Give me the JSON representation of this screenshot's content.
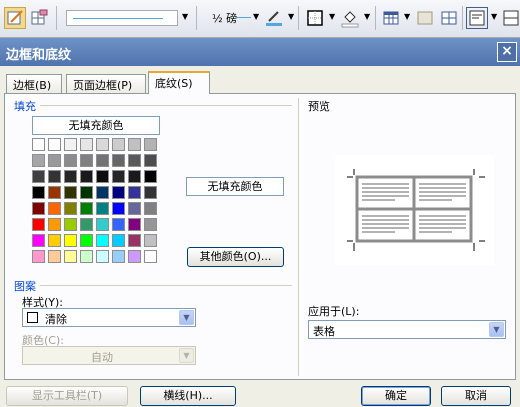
{
  "dialog": {
    "title": "边框和底纹"
  },
  "tabs": [
    {
      "label": "边框(B)",
      "active": false
    },
    {
      "label": "页面边框(P)",
      "active": false
    },
    {
      "label": "底纹(S)",
      "active": true
    }
  ],
  "fill": {
    "heading": "填充",
    "no_fill_button": "无填充颜色",
    "selected_display": "无填充颜色",
    "more_colors_button": "其他颜色(O)...",
    "palette_rows": [
      [
        "#ffffff",
        "#ffffff",
        "#f2f2f2",
        "#e6e6e6",
        "#d9d9d9",
        "#cccccc",
        "#c0c0c0",
        "#b3b3b3"
      ],
      [
        "#a6a6a6",
        "#999999",
        "#8c8c8c",
        "#808080",
        "#737373",
        "#666666",
        "#595959",
        "#4d4d4d"
      ],
      [
        "#404040",
        "#333333",
        "#262626",
        "#1a1a1a",
        "#0d0d0d",
        "#262626",
        "#1a1a1a",
        "#000000"
      ],
      [
        "#000000",
        "#993300",
        "#333300",
        "#003300",
        "#003366",
        "#000080",
        "#333399",
        "#333333"
      ],
      [
        "#800000",
        "#ff6600",
        "#808000",
        "#008000",
        "#008080",
        "#0000ff",
        "#666699",
        "#808080"
      ],
      [
        "#ff0000",
        "#ff9900",
        "#99cc00",
        "#339966",
        "#33cccc",
        "#3366ff",
        "#800080",
        "#969696"
      ],
      [
        "#ff00ff",
        "#ffcc00",
        "#ffff00",
        "#00ff00",
        "#00ffff",
        "#00ccff",
        "#993366",
        "#c0c0c0"
      ],
      [
        "#ff99cc",
        "#ffcc99",
        "#ffff99",
        "#ccffcc",
        "#ccffff",
        "#99ccff",
        "#cc99ff",
        "#ffffff"
      ]
    ]
  },
  "pattern": {
    "heading": "图案",
    "style_label": "样式(Y):",
    "style_value": "清除",
    "color_label": "颜色(C):",
    "color_value": "自动"
  },
  "preview": {
    "heading": "预览"
  },
  "apply_to": {
    "label": "应用于(L):",
    "value": "表格"
  },
  "footer": {
    "show_toolbar": "显示工具栏(T)",
    "horizontal_line": "横线(H)...",
    "ok": "确定",
    "cancel": "取消"
  },
  "toolbar": {
    "weight_label": "½ 磅"
  }
}
